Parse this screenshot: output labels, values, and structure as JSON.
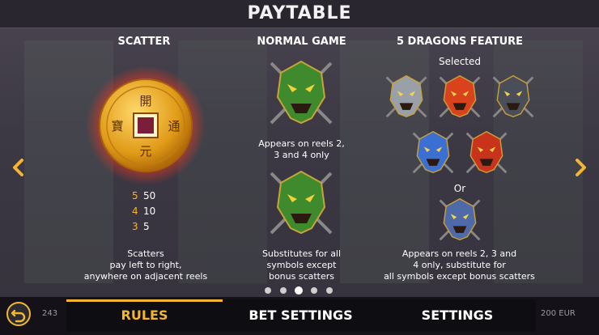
{
  "header": {
    "title": "PAYTABLE"
  },
  "scatter": {
    "heading": "SCATTER",
    "coin_chars": [
      "開",
      "寶",
      "通",
      "元"
    ],
    "payouts": [
      {
        "count": "5",
        "value": "50"
      },
      {
        "count": "4",
        "value": "10"
      },
      {
        "count": "3",
        "value": "5"
      }
    ],
    "desc": [
      "Scatters",
      "pay left to right,",
      "anywhere on adjacent reels"
    ]
  },
  "normal": {
    "heading": "NORMAL GAME",
    "desc1": [
      "Appears on reels 2,",
      "3 and 4 only"
    ],
    "desc2": [
      "Substitutes for all",
      "symbols except",
      "bonus scatters"
    ]
  },
  "dragons": {
    "heading": "5 DRAGONS FEATURE",
    "selected": "Selected",
    "or": "Or",
    "desc": [
      "Appears on reels 2, 3 and",
      "4 only, substitute for",
      "all symbols except bonus scatters"
    ],
    "colors": [
      "#9aa0a8",
      "#d8431e",
      "#4a4e58",
      "#3b6fd1",
      "#c9331c",
      "#4f6aa8"
    ]
  },
  "pager": {
    "count": 5,
    "active": 2
  },
  "tabs": [
    "RULES",
    "BET SETTINGS",
    "SETTINGS"
  ],
  "side": {
    "left_num": "243",
    "right_text": "200 EUR"
  },
  "colors": {
    "accent": "#f2b632",
    "coin": "#e0a01e",
    "coin_hole": "#7a1e3a"
  }
}
